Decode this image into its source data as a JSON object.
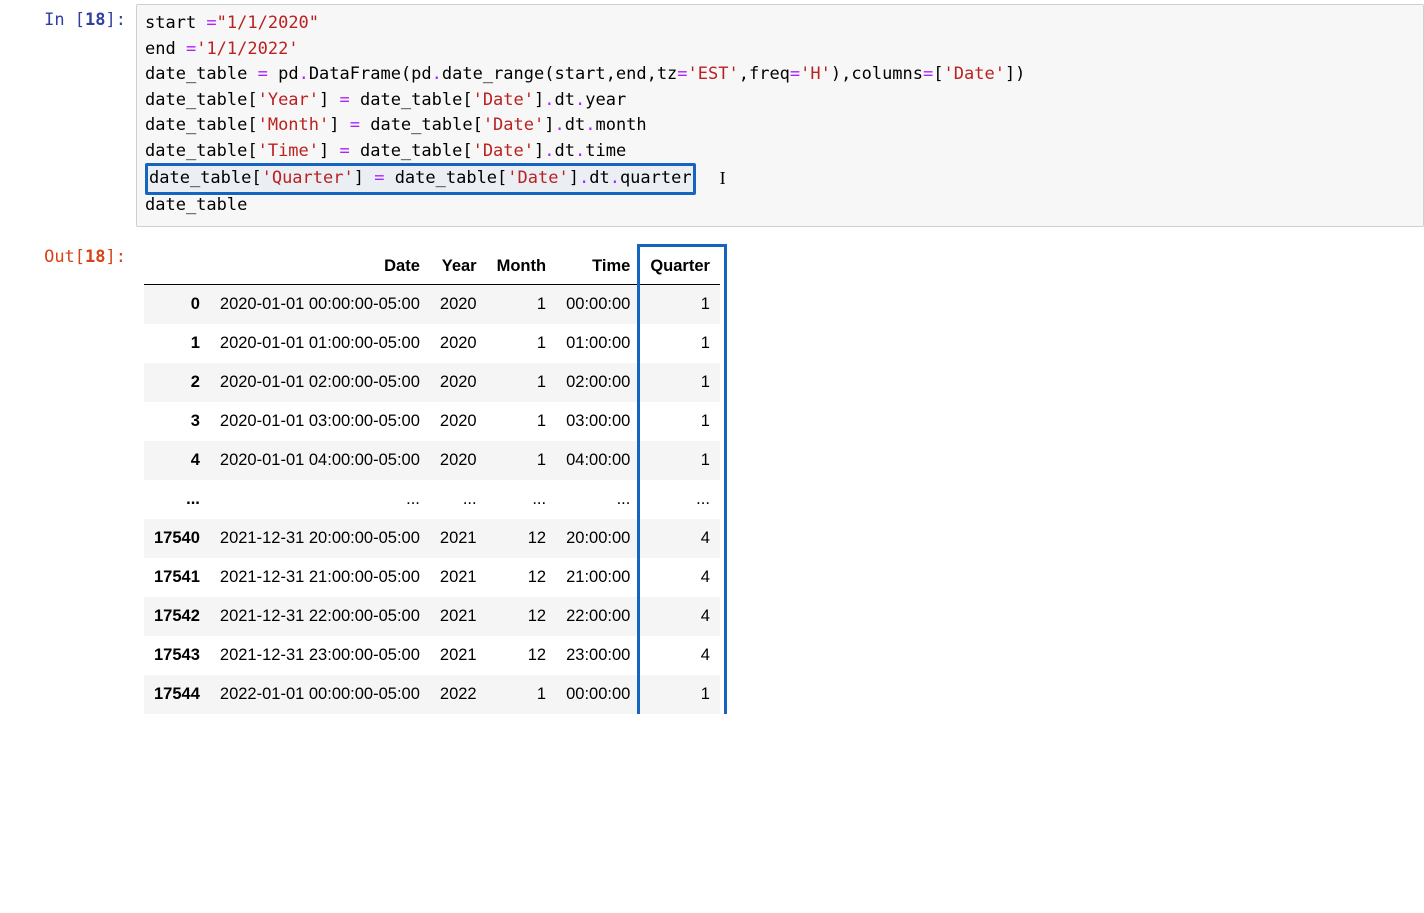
{
  "cell": {
    "exec_count": "18",
    "in_label_pre": "In [",
    "in_label_post": "]:",
    "out_label_pre": "Out[",
    "out_label_post": "]:",
    "code": {
      "l1": {
        "a": "start ",
        "op": "=",
        "s": "\"1/1/2020\""
      },
      "l2": {
        "a": "end ",
        "op": "=",
        "s": "'1/1/2022'"
      },
      "l3": {
        "a": "date_table ",
        "op": "=",
        "b": " pd",
        "dot1": ".",
        "c": "DataFrame(pd",
        "dot2": ".",
        "d": "date_range(start,end,tz",
        "op2": "=",
        "s1": "'EST'",
        "e": ",freq",
        "op3": "=",
        "s2": "'H'",
        "f": "),columns",
        "op4": "=",
        "g": "[",
        "s3": "'Date'",
        "h": "])"
      },
      "l4": {
        "a": "date_table[",
        "s1": "'Year'",
        "b": "] ",
        "op": "=",
        "c": " date_table[",
        "s2": "'Date'",
        "d": "]",
        "dot": ".",
        "e": "dt",
        "dot2": ".",
        "f": "year"
      },
      "l5": {
        "a": "date_table[",
        "s1": "'Month'",
        "b": "] ",
        "op": "=",
        "c": " date_table[",
        "s2": "'Date'",
        "d": "]",
        "dot": ".",
        "e": "dt",
        "dot2": ".",
        "f": "month"
      },
      "l6": {
        "a": "date_table[",
        "s1": "'Time'",
        "b": "] ",
        "op": "=",
        "c": " date_table[",
        "s2": "'Date'",
        "d": "]",
        "dot": ".",
        "e": "dt",
        "dot2": ".",
        "f": "time"
      },
      "l7": {
        "a": "date_table[",
        "s1": "'Quarter'",
        "b": "] ",
        "op": "=",
        "c": " date_table[",
        "s2": "'Date'",
        "d": "]",
        "dot": ".",
        "e": "dt",
        "dot2": ".",
        "f": "quarter"
      },
      "l8": {
        "a": "date_table"
      }
    }
  },
  "table": {
    "columns": [
      "",
      "Date",
      "Year",
      "Month",
      "Time",
      "Quarter"
    ],
    "rows": [
      {
        "idx": "0",
        "date": "2020-01-01 00:00:00-05:00",
        "year": "2020",
        "month": "1",
        "time": "00:00:00",
        "quarter": "1"
      },
      {
        "idx": "1",
        "date": "2020-01-01 01:00:00-05:00",
        "year": "2020",
        "month": "1",
        "time": "01:00:00",
        "quarter": "1"
      },
      {
        "idx": "2",
        "date": "2020-01-01 02:00:00-05:00",
        "year": "2020",
        "month": "1",
        "time": "02:00:00",
        "quarter": "1"
      },
      {
        "idx": "3",
        "date": "2020-01-01 03:00:00-05:00",
        "year": "2020",
        "month": "1",
        "time": "03:00:00",
        "quarter": "1"
      },
      {
        "idx": "4",
        "date": "2020-01-01 04:00:00-05:00",
        "year": "2020",
        "month": "1",
        "time": "04:00:00",
        "quarter": "1"
      },
      {
        "idx": "...",
        "date": "...",
        "year": "...",
        "month": "...",
        "time": "...",
        "quarter": "..."
      },
      {
        "idx": "17540",
        "date": "2021-12-31 20:00:00-05:00",
        "year": "2021",
        "month": "12",
        "time": "20:00:00",
        "quarter": "4"
      },
      {
        "idx": "17541",
        "date": "2021-12-31 21:00:00-05:00",
        "year": "2021",
        "month": "12",
        "time": "21:00:00",
        "quarter": "4"
      },
      {
        "idx": "17542",
        "date": "2021-12-31 22:00:00-05:00",
        "year": "2021",
        "month": "12",
        "time": "22:00:00",
        "quarter": "4"
      },
      {
        "idx": "17543",
        "date": "2021-12-31 23:00:00-05:00",
        "year": "2021",
        "month": "12",
        "time": "23:00:00",
        "quarter": "4"
      },
      {
        "idx": "17544",
        "date": "2022-01-01 00:00:00-05:00",
        "year": "2022",
        "month": "1",
        "time": "00:00:00",
        "quarter": "1"
      }
    ]
  },
  "highlight_column": "Quarter"
}
